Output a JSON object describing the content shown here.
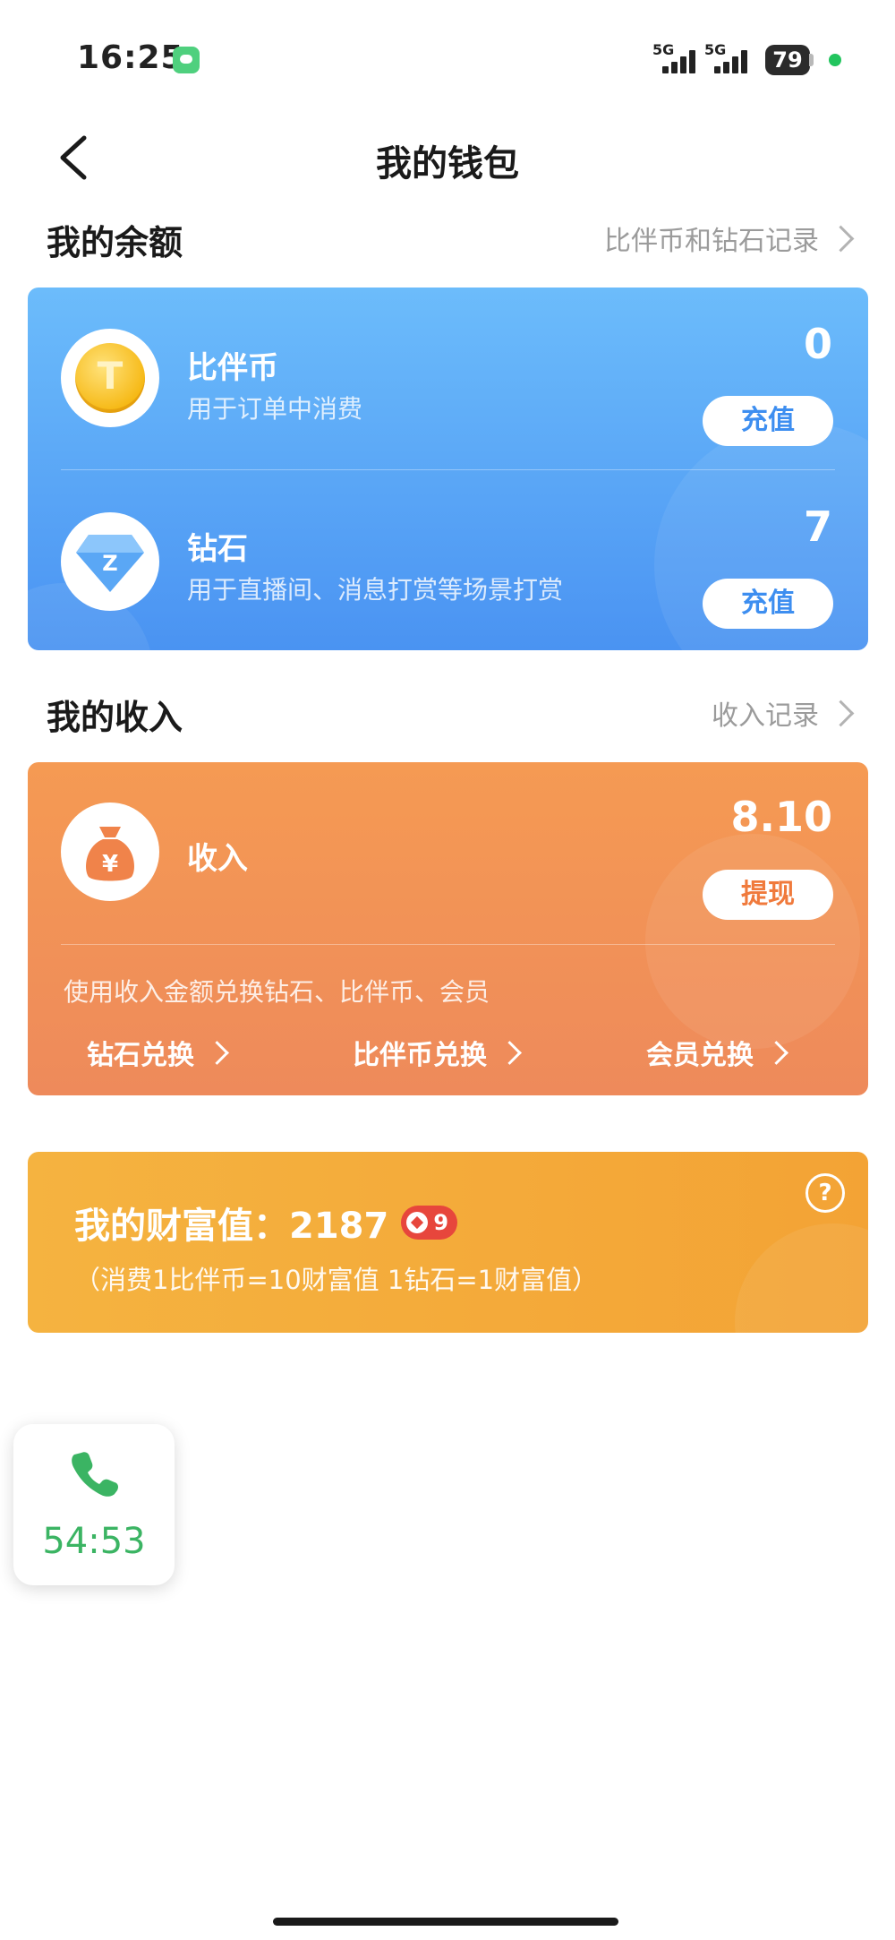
{
  "status_bar": {
    "time": "16:25",
    "network1": "5G",
    "network2": "5G",
    "battery": "79",
    "icons": [
      "chat-app-icon",
      "signal-icon",
      "battery-icon",
      "status-dot-icon"
    ]
  },
  "nav": {
    "back_icon": "chevron-left-icon",
    "title": "我的钱包"
  },
  "balance_section": {
    "title": "我的余额",
    "link_label": "比伴币和钻石记录",
    "items": [
      {
        "name": "比伴币",
        "desc": "用于订单中消费",
        "value": "0",
        "button_label": "充值",
        "icon": "coin-icon"
      },
      {
        "name": "钻石",
        "desc": "用于直播间、消息打赏等场景打赏",
        "value": "7",
        "button_label": "充值",
        "icon": "diamond-icon"
      }
    ]
  },
  "income_section": {
    "title": "我的收入",
    "link_label": "收入记录",
    "income_label": "收入",
    "value": "8.10",
    "withdraw_label": "提现",
    "note": "使用收入金额兑换钻石、比伴币、会员",
    "exchanges": [
      {
        "label": "钻石兑换"
      },
      {
        "label": "比伴币兑换"
      },
      {
        "label": "会员兑换"
      }
    ],
    "icon": "money-bag-icon"
  },
  "wealth": {
    "title": "我的财富值：2187",
    "level": "9",
    "subtitle": "（消费1比伴币=10财富值 1钻石=1财富值）",
    "help_label": "?"
  },
  "call_float": {
    "icon": "phone-icon",
    "time": "54:53",
    "color": "#3bb463"
  },
  "colors": {
    "balance_card": "#5aa8f7",
    "income_card": "#f1925a",
    "wealth_card": "#f4ab3a",
    "button_text": "#3d8ef0",
    "withdraw_text": "#f07a3c"
  }
}
